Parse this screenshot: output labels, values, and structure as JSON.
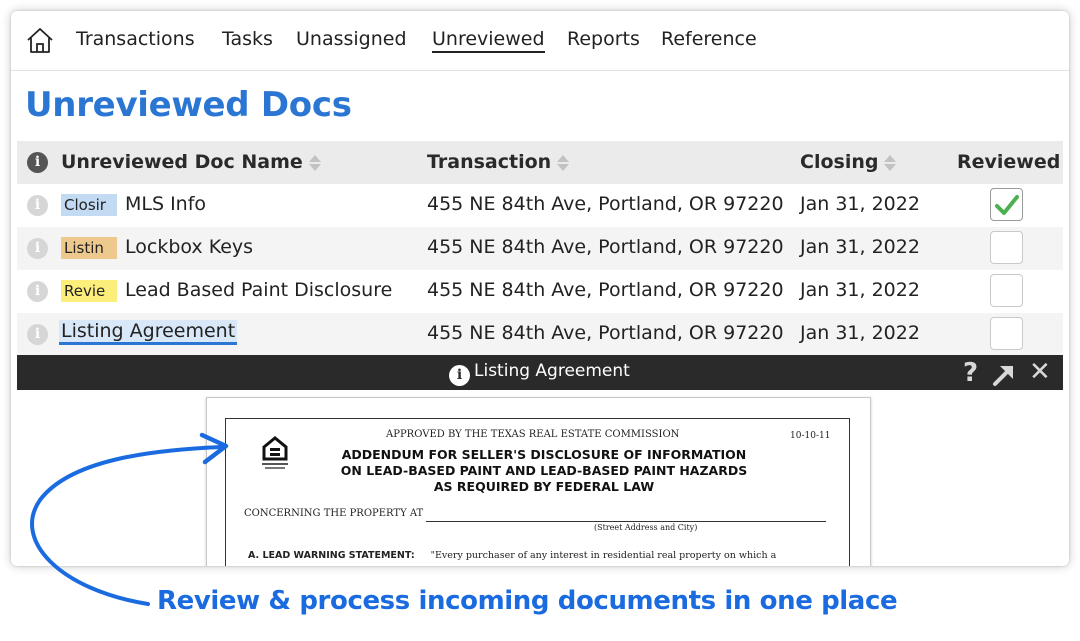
{
  "nav": {
    "items": [
      {
        "label": "Transactions"
      },
      {
        "label": "Tasks"
      },
      {
        "label": "Unassigned"
      },
      {
        "label": "Unreviewed"
      },
      {
        "label": "Reports"
      },
      {
        "label": "Reference"
      }
    ],
    "active": "Unreviewed"
  },
  "page": {
    "title": "Unreviewed Docs"
  },
  "table": {
    "headers": {
      "info": "i",
      "doc_name": "Unreviewed Doc Name",
      "transaction": "Transaction",
      "closing": "Closing",
      "reviewed": "Reviewed"
    },
    "rows": [
      {
        "tag": "Closir",
        "tag_color": "#c2daf2",
        "name": "MLS Info",
        "transaction": "455 NE 84th Ave, Portland, OR 97220",
        "closing": "Jan 31, 2022",
        "reviewed": true
      },
      {
        "tag": "Listin",
        "tag_color": "#edc98e",
        "name": "Lockbox Keys",
        "transaction": "455 NE 84th Ave, Portland, OR 97220",
        "closing": "Jan 31, 2022",
        "reviewed": false
      },
      {
        "tag": "Revie",
        "tag_color": "#fbee7b",
        "name": "Lead Based Paint Disclosure",
        "transaction": "455 NE 84th Ave, Portland, OR 97220",
        "closing": "Jan 31, 2022",
        "reviewed": false
      },
      {
        "tag": "",
        "name": "Listing Agreement",
        "transaction": "455 NE 84th Ave, Portland, OR 97220",
        "closing": "Jan 31, 2022",
        "reviewed": false
      }
    ]
  },
  "viewer": {
    "title": "Listing Agreement",
    "help": "?",
    "close": "✕",
    "document": {
      "approved": "APPROVED BY THE TEXAS REAL ESTATE COMMISSION",
      "date": "10-10-11",
      "heading_line1": "ADDENDUM FOR SELLER'S DISCLOSURE OF INFORMATION",
      "heading_line2": "ON LEAD-BASED PAINT AND LEAD-BASED PAINT HAZARDS",
      "heading_line3": "AS REQUIRED BY FEDERAL LAW",
      "concerning": "CONCERNING THE PROPERTY AT",
      "address_label": "(Street Address and City)",
      "warning_label": "A. LEAD WARNING STATEMENT:",
      "warning_text": "\"Every purchaser of any interest in residential real property on which a"
    }
  },
  "caption": "Review & process incoming documents in one place",
  "colors": {
    "accent": "#2b76d3",
    "caption": "#1a6be0",
    "check": "#4caf50"
  }
}
